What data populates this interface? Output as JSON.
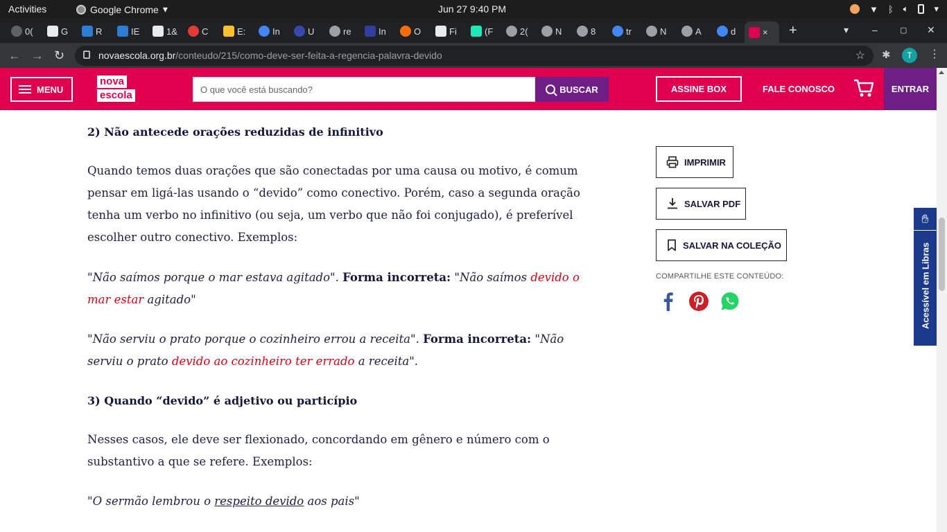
{
  "system": {
    "activities": "Activities",
    "app_name": "Google Chrome",
    "clock": "Jun 27  9:40 PM"
  },
  "tabs": [
    {
      "label": "0(",
      "color": "#5f6368"
    },
    {
      "label": "G",
      "color": "#e8eaed"
    },
    {
      "label": "R",
      "color": "#2d7dd2"
    },
    {
      "label": "IE",
      "color": "#2d7dd2"
    },
    {
      "label": "1&",
      "color": "#e8eaed"
    },
    {
      "label": "C",
      "color": "#e53935"
    },
    {
      "label": "E:",
      "color": "#fbc02d"
    },
    {
      "label": "In",
      "color": "#4285f4"
    },
    {
      "label": "U",
      "color": "#3949ab"
    },
    {
      "label": "re",
      "color": "#9aa0a6"
    },
    {
      "label": "In",
      "color": "#303f9f"
    },
    {
      "label": "O",
      "color": "#ff6d00"
    },
    {
      "label": "Fi",
      "color": "#e8eaed"
    },
    {
      "label": "(F",
      "color": "#1de9b6"
    },
    {
      "label": "2(",
      "color": "#9aa0a6"
    },
    {
      "label": "N",
      "color": "#9aa0a6"
    },
    {
      "label": "8",
      "color": "#9aa0a6"
    },
    {
      "label": "tr",
      "color": "#4285f4"
    },
    {
      "label": "N",
      "color": "#9aa0a6"
    },
    {
      "label": "A",
      "color": "#9aa0a6"
    },
    {
      "label": "d",
      "color": "#4285f4"
    },
    {
      "label": "×",
      "color": "#e0004d"
    }
  ],
  "browser": {
    "url_host": "novaescola.org.br",
    "url_path": "/conteudo/215/como-deve-ser-feita-a-regencia-palavra-devido",
    "profile_initial": "T"
  },
  "header": {
    "menu_label": "MENU",
    "logo_line1": "nova",
    "logo_line2": "escola",
    "search_placeholder": "O que você está buscando?",
    "search_button": "BUSCAR",
    "assine_label": "ASSINE BOX",
    "fale_label": "FALE CONOSCO",
    "entrar_label": "ENTRAR",
    "brand_color": "#e0004d",
    "accent_color": "#6e1e85"
  },
  "article": {
    "heading2": "2) Não antecede orações reduzidas de infinitivo",
    "para1": "Quando temos duas orações que são conectadas por uma causa ou motivo, é comum pensar em ligá-las usando o “devido” como conectivo. Porém, caso a segunda oração tenha um verbo no infinitivo (ou seja, um verbo que não foi conjugado), é preferível escolher outro conectivo. Exemplos:",
    "ex1_a": "\"Não saímos porque o mar estava agitado\".",
    "ex1_label": "Forma incorreta:",
    "ex1_b": "\"Não saímos",
    "ex1_red": "devido o mar estar",
    "ex1_c": "agitado\"",
    "ex2_a": "\"Não serviu o prato porque o cozinheiro errou a receita\".",
    "ex2_label": "Forma incorreta:",
    "ex2_b": "\"Não serviu o prato",
    "ex2_red": "devido ao cozinheiro ter errado",
    "ex2_c": "a receita\".",
    "heading3": "3) Quando “devido” é adjetivo ou particípio",
    "para2": "Nesses casos, ele deve ser flexionado, concordando em gênero e número com o substantivo a que se refere. Exemplos:",
    "ex3_a": "\"O sermão lembrou o",
    "ex3_u": "respeito devido",
    "ex3_b": "aos pais\""
  },
  "sidebar": {
    "print_label": "IMPRIMIR",
    "pdf_label": "SALVAR PDF",
    "collection_label": "SALVAR NA COLEÇÃO",
    "share_label": "COMPARTILHE ESTE CONTEÚDO:",
    "social_icons": [
      "facebook-icon",
      "pinterest-icon",
      "whatsapp-icon"
    ]
  },
  "libras": {
    "label": "Acessível em Libras"
  }
}
